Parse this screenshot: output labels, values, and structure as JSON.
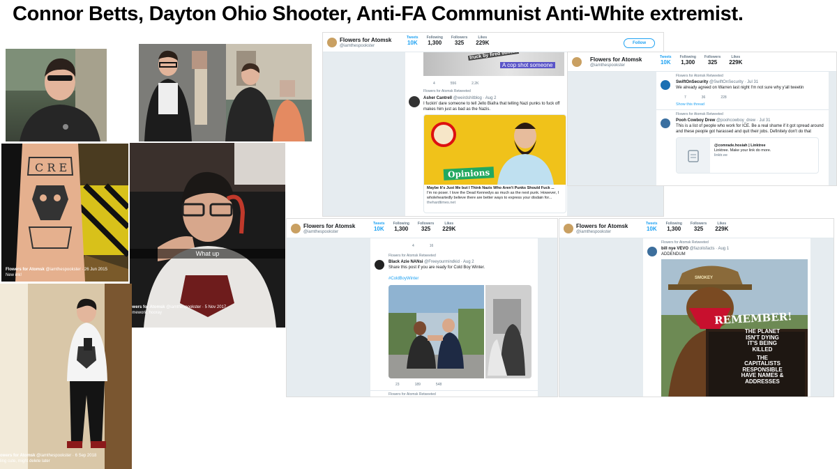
{
  "title": "Connor Betts, Dayton Ohio Shooter, Anti-FA Communist Anti-White extremist.",
  "photos": {
    "p4_cap_name": "Flowers for Atomsk",
    "p4_cap_handle": "@iamthespookster · 26 Jun 2015",
    "p4_cap_text": "New ink!",
    "p5_overlay": "What up",
    "p5_cap_name": "owers for Atomsk",
    "p5_cap_handle": "@iamthespookster · 5 Nov 2017",
    "p5_cap_text": "omework, hooray",
    "p6_cap_name": "owers for Atomsk",
    "p6_cap_handle": "@iamthespookster · 6 Sep 2018",
    "p6_cap_text": "ling cute, might delete later"
  },
  "profile": {
    "name": "Flowers for Atomsk",
    "handle": "@iamthespookster",
    "tweets_label": "Tweets",
    "tweets": "10K",
    "following_label": "Following",
    "following": "1,300",
    "followers_label": "Followers",
    "followers": "325",
    "likes_label": "Likes",
    "likes": "229K",
    "follow_btn": "Follow",
    "retweeted": "Flowers for Atomsk Retweeted"
  },
  "panel1": {
    "meme_text1": "truck by fired bullet?",
    "meme_text2": "A cop shot someone",
    "acts": [
      "4",
      "556",
      "2.2K"
    ],
    "t_name": "Asher Cantrell",
    "t_handle": "@weirdshitblog · Aug 2",
    "t_text": "I fuckin' dare someone to tell Jello Biafra that telling Nazi punks to fuck off makes him just as bad as the Nazis.",
    "card_banner": "Opinions",
    "card_title": "Maybe It's Just Me but I Think Nazis Who Aren't Punks Should Fuck ...",
    "card_desc": "I'm no poser. I love the Dead Kennedys as much as the next punk. However, I wholeheartedly believe there are better ways to express your disdain for...",
    "card_url": "thehardtimes.net"
  },
  "panel2": {
    "t1_name": "SwiftOnSecurity",
    "t1_handle": "@SwiftOnSecurity · Jul 31",
    "t1_text": "We already agreed on Warren last night I'm not sure why y'all tweetin",
    "t1_acts": [
      "7",
      "36",
      "228"
    ],
    "t1_thread": "Show this thread",
    "t2_name": "Pooh Cowboy Drew",
    "t2_handle": "@poohcowboy_drew · Jul 31",
    "t2_text": "This is a list of people who work for ICE. Be a real shame if it got spread around and these people got harassed and quit their jobs. Definitely don't do that",
    "card_title": "@comrade.hosiah | Linktree",
    "card_desc": "Linktree. Make your link do more.",
    "card_url": "linktr.ee"
  },
  "panel3": {
    "top_acts": [
      "4",
      "16"
    ],
    "t_name": "Black Azie NANsi",
    "t_handle": "@Freeyourmindkid · Aug 2",
    "t_text": "Share this post if you are ready for Cold Boy Winter.",
    "t_hashtag": "#ColdBoyWinter",
    "acts": [
      "23",
      "189",
      "548"
    ]
  },
  "panel4": {
    "t_name": "bill nye VEVO",
    "t_handle": "@fazolisfacts · Aug 1",
    "t_text": "ADDENDUM",
    "hat_text": "SMOKEY",
    "sign_title": "REMEMBER!",
    "sign_lines": [
      "THE PLANET",
      "ISN'T DYING",
      "IT'S BEING",
      "KILLED",
      "",
      "THE",
      "CAPITALISTS",
      "RESPONSIBLE",
      "HAVE NAMES &",
      "ADDRESSES"
    ]
  }
}
